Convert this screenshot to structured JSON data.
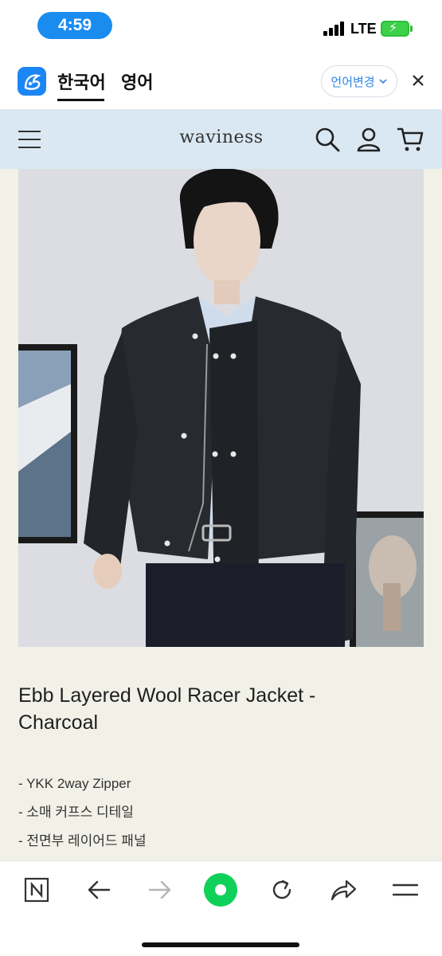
{
  "status_bar": {
    "time": "4:59",
    "network": "LTE"
  },
  "translator": {
    "logo_icon": "papago-icon",
    "tabs": [
      {
        "label": "한국어",
        "active": true
      },
      {
        "label": "영어",
        "active": false
      }
    ],
    "language_change_label": "언어변경",
    "close_icon": "close-icon"
  },
  "site_header": {
    "brand": "waviness",
    "icons": [
      "menu-icon",
      "search-icon",
      "user-icon",
      "cart-icon"
    ]
  },
  "product": {
    "image_alt": "Model wearing charcoal wool racer jacket",
    "title": "Ebb Layered Wool Racer Jacket - Charcoal",
    "details": [
      "- YKK 2way Zipper",
      "- 소매 커프스 디테일",
      "- 전면부 레이어드 패널"
    ]
  },
  "browser_toolbar": {
    "buttons": [
      "naver-icon",
      "back-icon",
      "forward-icon",
      "green-dot-icon",
      "reload-icon",
      "share-icon",
      "menu-icon"
    ]
  },
  "colors": {
    "accent_blue": "#1a8cf0",
    "header_bg": "#d9e8f2",
    "page_bg": "#f2f1e8",
    "green_button": "#0fd15a"
  }
}
